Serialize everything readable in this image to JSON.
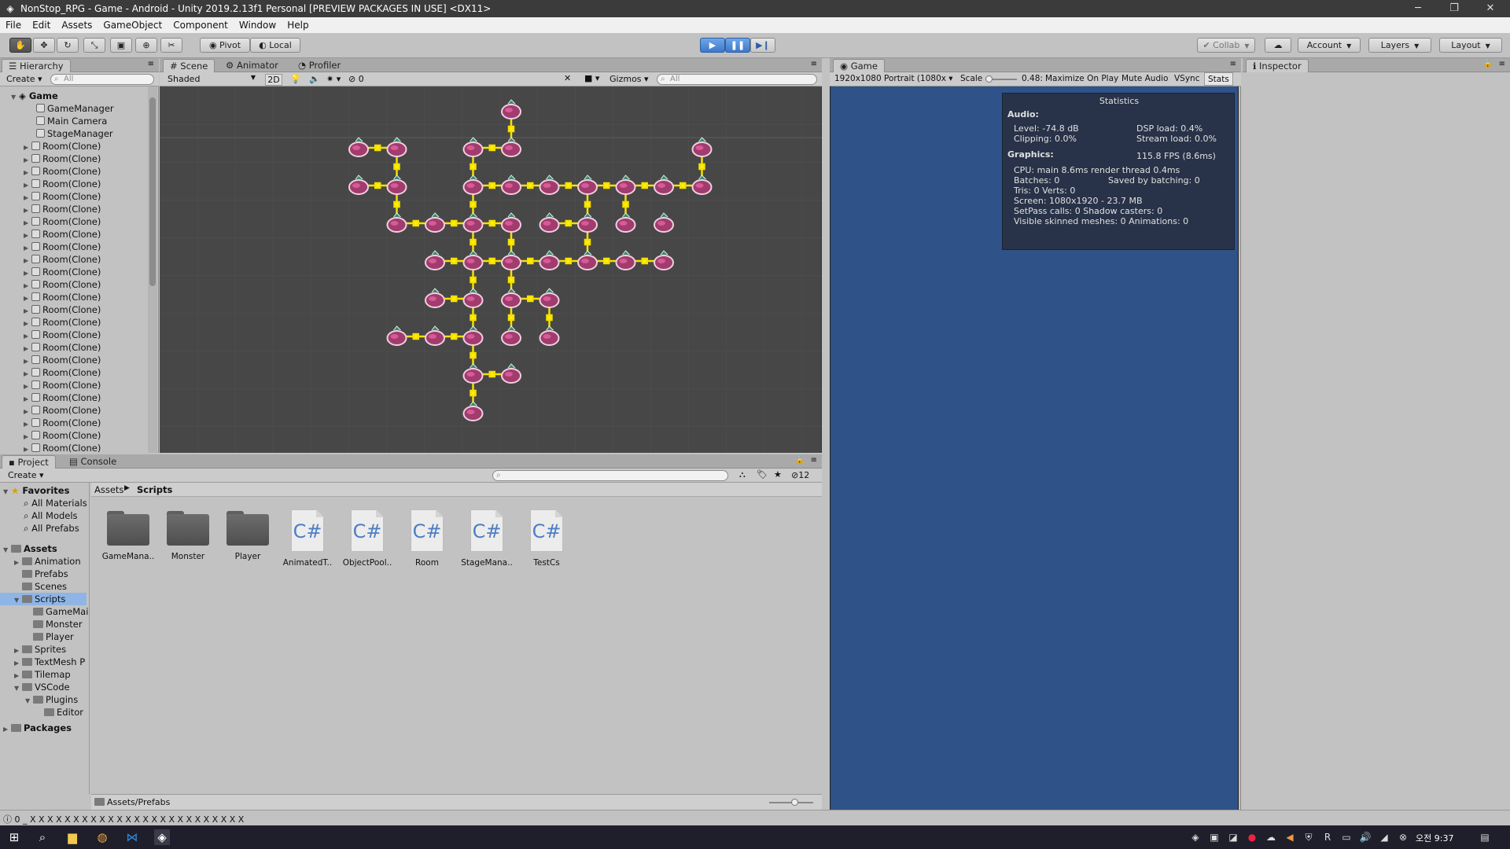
{
  "window": {
    "title": "NonStop_RPG - Game - Android - Unity 2019.2.13f1 Personal [PREVIEW PACKAGES IN USE] <DX11>"
  },
  "menu": [
    "File",
    "Edit",
    "Assets",
    "GameObject",
    "Component",
    "Window",
    "Help"
  ],
  "toolbar": {
    "pivot": "Pivot",
    "local": "Local",
    "collab": "Collab",
    "account": "Account",
    "layers": "Layers",
    "layout": "Layout"
  },
  "hierarchy": {
    "tab": "Hierarchy",
    "create": "Create",
    "search_placeholder": "All",
    "scene": "Game",
    "items": [
      "GameManager",
      "Main Camera",
      "StageManager"
    ],
    "clone_label": "Room(Clone)"
  },
  "scene": {
    "tabs": [
      "Scene",
      "Animator",
      "Profiler"
    ],
    "shading": "Shaded",
    "mode2d": "2D",
    "fx_count": "0",
    "gizmos": "Gizmos",
    "search_placeholder": "All"
  },
  "game": {
    "tab": "Game",
    "resolution": "1920x1080 Portrait (1080x",
    "scale_label": "Scale",
    "scale_value": "0.48:",
    "maximize": "Maximize On Play",
    "mute": "Mute Audio",
    "vsync": "VSync",
    "stats_btn": "Stats",
    "viewport_color": "#2f5288"
  },
  "statistics": {
    "title": "Statistics",
    "audio_header": "Audio:",
    "level": "Level: -74.8 dB",
    "dsp": "DSP load: 0.4%",
    "clipping": "Clipping: 0.0%",
    "stream": "Stream load: 0.0%",
    "graphics_header": "Graphics:",
    "fps": "115.8 FPS (8.6ms)",
    "cpu": "CPU: main 8.6ms  render thread 0.4ms",
    "batches": "Batches: 0",
    "saved": "Saved by batching: 0",
    "tris": "Tris: 0     Verts: 0",
    "screen": "Screen: 1080x1920 - 23.7 MB",
    "setpass": "SetPass calls: 0      Shadow casters: 0",
    "skinned": "Visible skinned meshes: 0  Animations: 0"
  },
  "inspector": {
    "tab": "Inspector"
  },
  "project": {
    "tabs": [
      "Project",
      "Console"
    ],
    "create": "Create",
    "hidden_count": "12",
    "breadcrumb": [
      "Assets",
      "Scripts"
    ],
    "favorites_header": "Favorites",
    "favorites": [
      "All Materials",
      "All Models",
      "All Prefabs"
    ],
    "assets_header": "Assets",
    "tree": [
      {
        "label": "Animation",
        "depth": 1,
        "arrow": "right"
      },
      {
        "label": "Prefabs",
        "depth": 1,
        "arrow": ""
      },
      {
        "label": "Scenes",
        "depth": 1,
        "arrow": ""
      },
      {
        "label": "Scripts",
        "depth": 1,
        "arrow": "down",
        "selected": true
      },
      {
        "label": "GameMai",
        "depth": 2,
        "arrow": ""
      },
      {
        "label": "Monster",
        "depth": 2,
        "arrow": ""
      },
      {
        "label": "Player",
        "depth": 2,
        "arrow": ""
      },
      {
        "label": "Sprites",
        "depth": 1,
        "arrow": "right"
      },
      {
        "label": "TextMesh P",
        "depth": 1,
        "arrow": "right"
      },
      {
        "label": "Tilemap",
        "depth": 1,
        "arrow": "right"
      },
      {
        "label": "VSCode",
        "depth": 1,
        "arrow": "down"
      },
      {
        "label": "Plugins",
        "depth": 2,
        "arrow": "down"
      },
      {
        "label": "Editor",
        "depth": 3,
        "arrow": ""
      }
    ],
    "packages_header": "Packages",
    "assets": [
      {
        "type": "folder",
        "label": "GameMana.."
      },
      {
        "type": "folder",
        "label": "Monster"
      },
      {
        "type": "folder",
        "label": "Player"
      },
      {
        "type": "cs",
        "label": "AnimatedT.."
      },
      {
        "type": "cs",
        "label": "ObjectPool.."
      },
      {
        "type": "cs",
        "label": "Room"
      },
      {
        "type": "cs",
        "label": "StageMana.."
      },
      {
        "type": "cs",
        "label": "TestCs"
      }
    ],
    "cs_glyph": "C#",
    "footer_path": "Assets/Prefabs"
  },
  "statusbar": {
    "message": "0 _ X X X X X X X X X X X X X X X X X X X X X X X X X"
  },
  "taskbar": {
    "clock": "오전 9:37"
  }
}
